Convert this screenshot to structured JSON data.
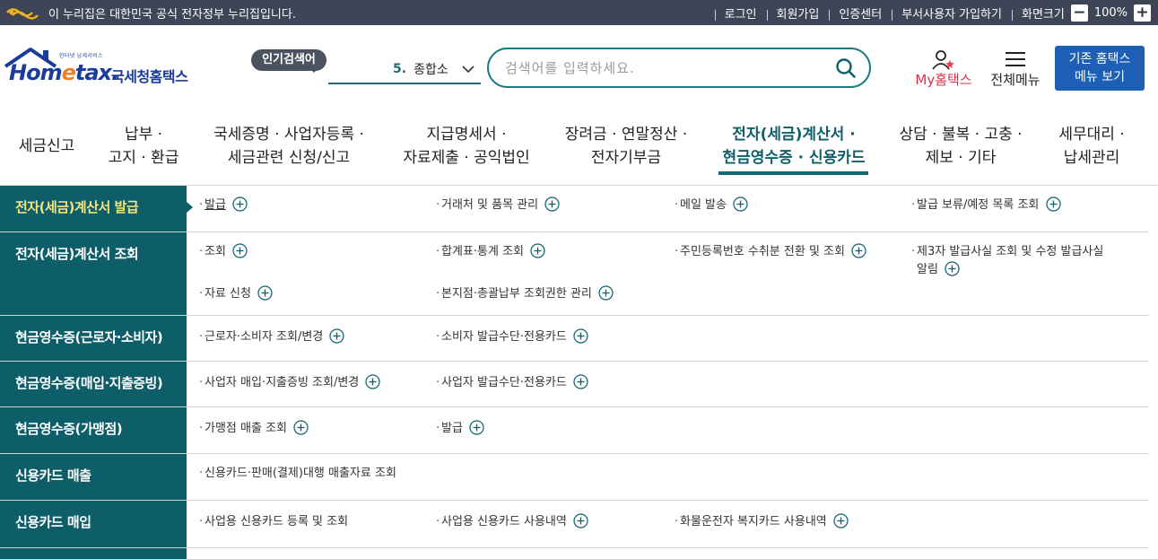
{
  "topbar": {
    "gov_notice": "이 누리집은 대한민국 공식 전자정부 누리집입니다.",
    "links": [
      "로그인",
      "회원가입",
      "인증센터",
      "부서사용자 가입하기"
    ],
    "zoom_label": "화면크기",
    "zoom_minus": "−",
    "zoom_value": "100%",
    "zoom_plus": "+"
  },
  "header": {
    "logo_small": "한터넷 납세서비스",
    "logo_word_pre": "Hom",
    "logo_word_e": "e",
    "logo_word_post": "tax.",
    "logo_kr": "국세청홈택스",
    "popular_label": "인기검색어",
    "rank_num": "5.",
    "rank_term": "종합소",
    "search_placeholder": "검색어를 입력하세요.",
    "my_label_my": "My",
    "my_label_rest": "홈택스",
    "all_menu_label": "전체메뉴",
    "legacy_line1": "기존 홈택스",
    "legacy_line2": "메뉴 보기"
  },
  "gnb": {
    "items": [
      {
        "l1": "세금신고",
        "l2": ""
      },
      {
        "l1": "납부 ·",
        "l2": "고지 · 환급"
      },
      {
        "l1": "국세증명 · 사업자등록 ·",
        "l2": "세금관련 신청/신고"
      },
      {
        "l1": "지급명세서 ·",
        "l2": "자료제출 · 공익법인"
      },
      {
        "l1": "장려금 · 연말정산 ·",
        "l2": "전자기부금"
      },
      {
        "l1": "전자(세금)계산서 ·",
        "l2": "현금영수증 · 신용카드"
      },
      {
        "l1": "상담 · 불복 · 고충 ·",
        "l2": "제보 · 기타"
      },
      {
        "l1": "세무대리 ·",
        "l2": "납세관리"
      }
    ]
  },
  "submenu": {
    "rows": [
      {
        "category": "전자(세금)계산서 발급",
        "items": [
          "발급",
          "거래처 및 품목 관리",
          "메일 발송",
          "발급 보류/예정 목록 조회"
        ]
      },
      {
        "category": "전자(세금)계산서 조회",
        "items": [
          "조회",
          "합계표·통계 조회",
          "주민등록번호 수취분 전환 및 조회",
          "제3자 발급사실 조회 및 수정 발급사실",
          "알림",
          "자료 신청",
          "본지점·총괄납부 조회권한 관리"
        ]
      },
      {
        "category": "현금영수증(근로자·소비자)",
        "items": [
          "근로자·소비자 조회/변경",
          "소비자 발급수단·전용카드"
        ]
      },
      {
        "category": "현금영수증(매입·지출증빙)",
        "items": [
          "사업자 매입·지출증빙 조회/변경",
          "사업자 발급수단·전용카드"
        ]
      },
      {
        "category": "현금영수증(가맹점)",
        "items": [
          "가맹점 매출 조회",
          "발급"
        ]
      },
      {
        "category": "신용카드 매출",
        "items": [
          "신용카드·판매(결제)대행 매출자료 조회"
        ]
      },
      {
        "category": "신용카드 매입",
        "items": [
          "사업용 신용카드 등록 및 조회",
          "사업용 신용카드 사용내역",
          "화물운전자 복지카드 사용내역"
        ]
      }
    ]
  },
  "colors": {
    "topbar_bg": "#3d4556",
    "teal": "#0d5e69",
    "accent_yellow": "#f7e57c",
    "legacy_blue": "#1c5fb5",
    "my_red": "#d92e4a"
  }
}
